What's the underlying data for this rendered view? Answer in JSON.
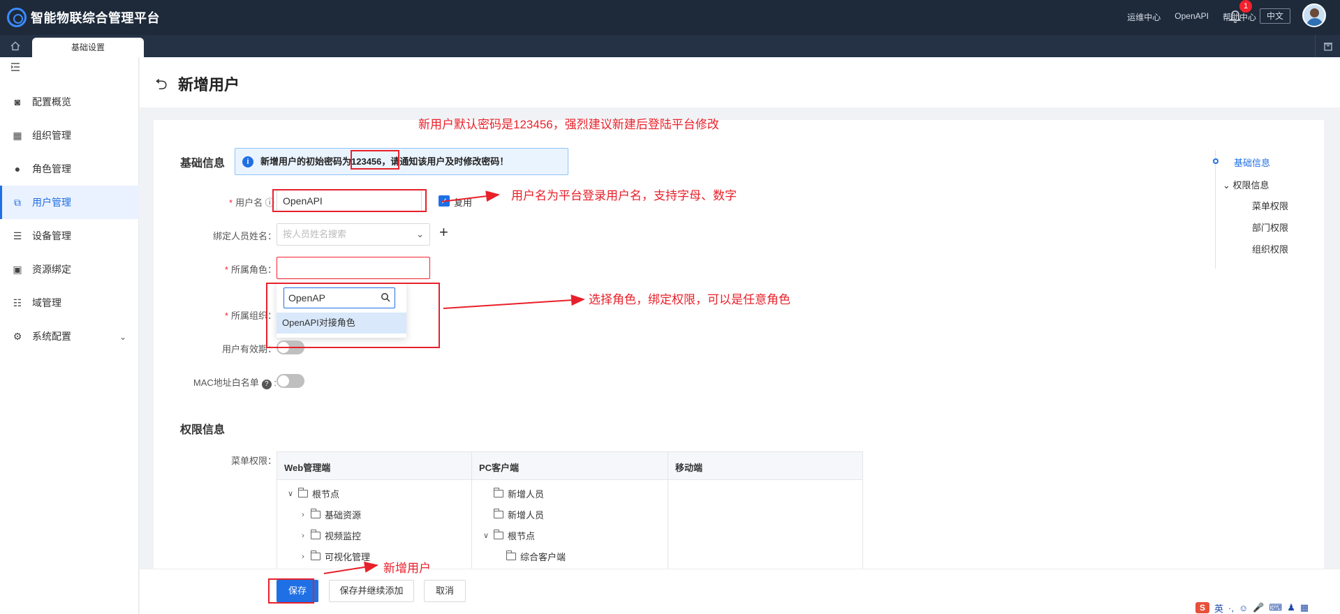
{
  "app": {
    "title": "智能物联综合管理平台",
    "links": [
      "运维中心",
      "OpenAPI",
      "帮助中心"
    ],
    "notification_count": "1",
    "language": "中文"
  },
  "tabs": {
    "active": "基础设置"
  },
  "sidebar": {
    "items": [
      {
        "label": "配置概览",
        "icon": "dashboard-icon"
      },
      {
        "label": "组织管理",
        "icon": "org-icon"
      },
      {
        "label": "角色管理",
        "icon": "role-icon"
      },
      {
        "label": "用户管理",
        "icon": "user-icon",
        "active": true
      },
      {
        "label": "设备管理",
        "icon": "device-icon"
      },
      {
        "label": "资源绑定",
        "icon": "resource-icon"
      },
      {
        "label": "域管理",
        "icon": "domain-icon"
      },
      {
        "label": "系统配置",
        "icon": "gear-icon"
      }
    ]
  },
  "page": {
    "title": "新增用户"
  },
  "basic": {
    "section_title": "基础信息",
    "notice_text": "新增用户的初始密码为123456，请通知该用户及时修改密码！",
    "username_label": "用户名",
    "username_value": "OpenAPI",
    "reuse_label": "复用",
    "bind_person_label": "绑定人员姓名：",
    "bind_person_placeholder": "按人员姓名搜索",
    "role_label": "所属角色：",
    "org_label": "所属组织：",
    "validity_label": "用户有效期：",
    "mac_label": "MAC地址白名单"
  },
  "role_dropdown": {
    "search_value": "OpenAP",
    "options": [
      "OpenAPI对接角色"
    ]
  },
  "permission": {
    "section_title": "权限信息",
    "menu_label": "菜单权限：",
    "columns": [
      "Web管理端",
      "PC客户端",
      "移动端"
    ],
    "web_tree": [
      "根节点",
      "基础资源",
      "视频监控",
      "可视化管理"
    ],
    "pc_tree": [
      "新增人员",
      "新增人员",
      "根节点",
      "综合客户端"
    ]
  },
  "anchor_nav": [
    "基础信息",
    "权限信息",
    "菜单权限",
    "部门权限",
    "组织权限"
  ],
  "footer": {
    "save": "保存",
    "save_continue": "保存并继续添加",
    "cancel": "取消"
  },
  "annotations": {
    "password_note": "新用户默认密码是123456，强烈建议新建后登陆平台修改",
    "username_note": "用户名为平台登录用户名，支持字母、数字",
    "role_note": "选择角色，绑定权限，可以是任意角色",
    "save_note": "新增用户"
  },
  "ime": {
    "mode": "英"
  },
  "colors": {
    "primary": "#1f6fe5",
    "annotation": "#e8202a",
    "topbar": "#1e2a3a"
  }
}
